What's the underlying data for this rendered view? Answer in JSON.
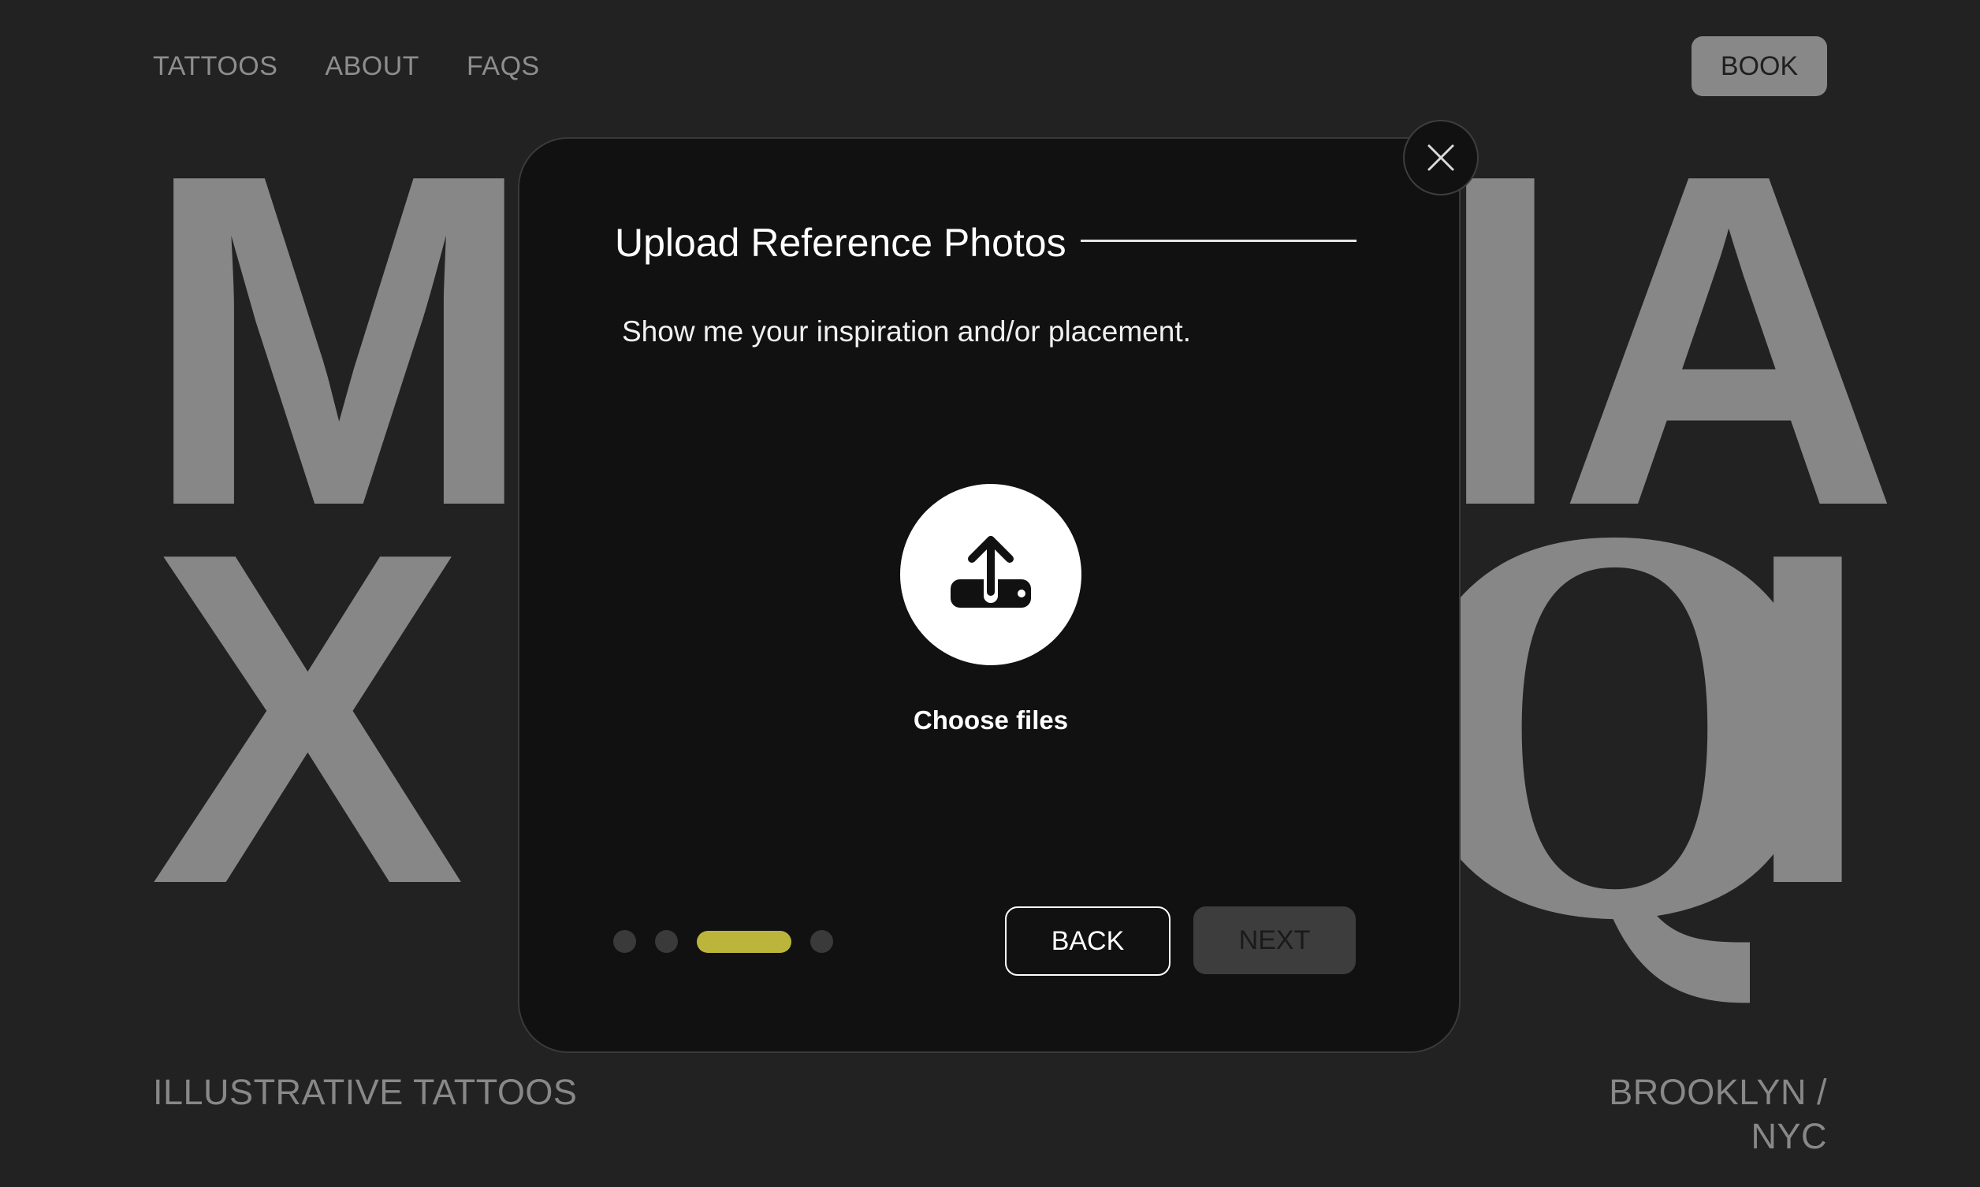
{
  "nav": {
    "links": [
      "TATTOOS",
      "ABOUT",
      "FAQS"
    ],
    "book_label": "BOOK"
  },
  "hero": {
    "line1_left": "M",
    "line1_right": "IA",
    "line2_left": "X",
    "line2_right": "I",
    "blackletter": "Q"
  },
  "footer": {
    "left": "ILLUSTRATIVE TATTOOS",
    "right": "BROOKLYN / NYC"
  },
  "modal": {
    "title": "Upload Reference Photos",
    "subtitle": "Show me your inspiration and/or placement.",
    "upload_icon": "upload-icon",
    "close_icon": "close-icon",
    "choose_files_label": "Choose files",
    "back_label": "BACK",
    "next_label": "NEXT",
    "steps_total": 4,
    "current_step": 3
  },
  "colors": {
    "background": "#222222",
    "modal_bg": "#111111",
    "accent_step": "#bcb53c",
    "muted_text": "#888888"
  }
}
